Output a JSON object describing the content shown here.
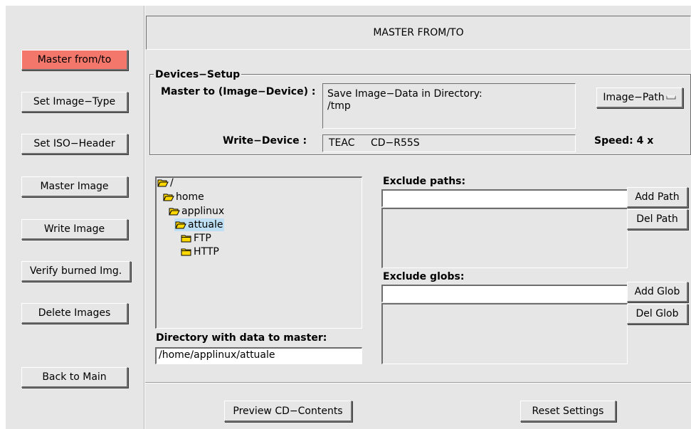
{
  "sidebar": {
    "buttons": [
      {
        "label": "Master from/to",
        "active": true
      },
      {
        "label": "Set Image−Type",
        "active": false
      },
      {
        "label": "Set ISO−Header",
        "active": false
      },
      {
        "label": "Master Image",
        "active": false
      },
      {
        "label": "Write Image",
        "active": false
      },
      {
        "label": "Verify burned Img.",
        "active": false
      },
      {
        "label": "Delete Images",
        "active": false
      },
      {
        "label": "Back to Main",
        "active": false
      }
    ]
  },
  "header": {
    "title": "MASTER FROM/TO"
  },
  "devices": {
    "group_title": "Devices−Setup",
    "master_to_label": "Master to (Image−Device) :",
    "master_to_line1": "Save Image−Data in Directory:",
    "master_to_line2": "/tmp",
    "image_path_button": "Image−Path",
    "write_device_label": "Write−Device :",
    "write_device_vendor": "TEAC",
    "write_device_model": "CD−R55S",
    "speed_label": "Speed:",
    "speed_value": "4 x"
  },
  "tree": {
    "items": [
      {
        "label": "/",
        "state": "open"
      },
      {
        "label": "home",
        "state": "open"
      },
      {
        "label": "applinux",
        "state": "open"
      },
      {
        "label": "attuale",
        "state": "open",
        "selected": true
      },
      {
        "label": "FTP",
        "state": "closed"
      },
      {
        "label": "HTTP",
        "state": "closed"
      }
    ]
  },
  "directory": {
    "label": "Directory with data to master:",
    "value": "/home/applinux/attuale"
  },
  "exclude_paths": {
    "label": "Exclude paths:",
    "input_value": "",
    "add_button": "Add Path",
    "del_button": "Del Path"
  },
  "exclude_globs": {
    "label": "Exclude globs:",
    "input_value": "",
    "add_button": "Add Glob",
    "del_button": "Del Glob"
  },
  "footer": {
    "preview_button": "Preview CD−Contents",
    "reset_button": "Reset Settings"
  },
  "colors": {
    "window_bg": "#e6e6e6",
    "active_button": "#f4776c",
    "selection": "#bfe0f4"
  },
  "icons": {
    "open_folder": "folder-open-icon",
    "closed_folder": "folder-closed-icon",
    "image_path_indicator": "option-menu-indicator-icon"
  }
}
